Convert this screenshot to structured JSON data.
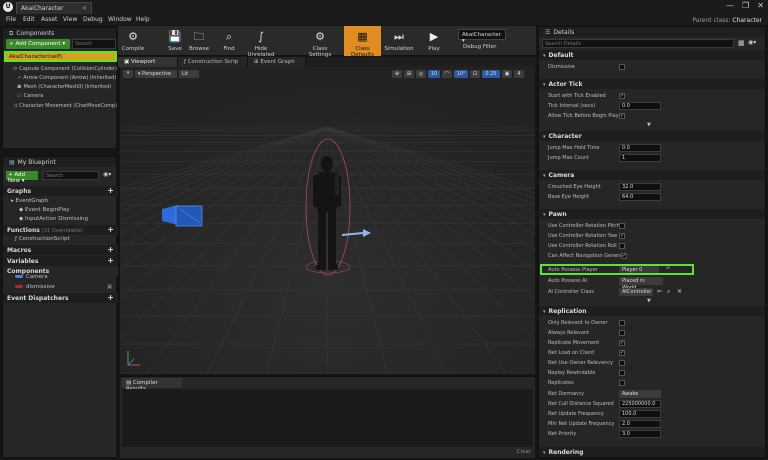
{
  "titlebar": {
    "logo": "U",
    "tab_title": "AkaiCharacter",
    "minimize": "—",
    "restore": "❐",
    "close": "✕"
  },
  "menubar": {
    "items": [
      "File",
      "Edit",
      "Asset",
      "View",
      "Debug",
      "Window",
      "Help"
    ],
    "parent_class_label": "Parent class:",
    "parent_class_value": "Character"
  },
  "components": {
    "title": "Components",
    "add_button": "+ Add Component ▾",
    "search_placeholder": "Search",
    "self_item": "AkaiCharacter(self)",
    "tree": [
      "Capsule Component (CollisionCylinder)",
      "Arrow Component (Arrow) (Inherited)",
      "Mesh (CharacterMesh0) (Inherited)",
      "Camera",
      "Character Movement (CharMoveComp)"
    ]
  },
  "my_blueprint": {
    "title": "My Blueprint",
    "add_button": "+ Add New ▾",
    "search_placeholder": "Search",
    "categories": {
      "graphs": "Graphs",
      "functions": "Functions",
      "functions_sub": "(31 Overridable)",
      "macros": "Macros",
      "variables": "Variables",
      "components": "Components",
      "dispatchers": "Event Dispatchers"
    },
    "graph_items": [
      "EventGraph",
      "Event BeginPlay",
      "InputAction Dismissing"
    ],
    "function_items": [
      "ConstructionScript"
    ],
    "component_vars": [
      "Camera",
      "dismissive"
    ],
    "var_colors": [
      "#4d7fd8",
      "#b0243a"
    ]
  },
  "toolbar": {
    "compile": "Compile",
    "save": "Save",
    "browse": "Browse",
    "find": "Find",
    "hide_unrelated": "Hide Unrelated",
    "class_settings": "Class Settings",
    "class_defaults": "Class Defaults",
    "simulation": "Simulation",
    "play": "Play",
    "debug_object": "AkaiCharacter ▾",
    "debug_filter": "Debug Filter"
  },
  "tabs": [
    "Viewport",
    "Construction Scrip",
    "Event Graph"
  ],
  "viewport": {
    "menu": "▾",
    "perspective": "Perspective",
    "lit": "Lit",
    "right_controls": [
      "⊕",
      "⊞",
      "◎",
      "10",
      "⌒",
      "10°",
      "⊡",
      "0.25",
      "▣",
      "4"
    ]
  },
  "compiler": {
    "title": "Compiler Results",
    "clear": "Clear"
  },
  "details": {
    "title": "Details",
    "search_placeholder": "Search Details",
    "sections": {
      "default": "Default",
      "actor_tick": "Actor Tick",
      "character": "Character",
      "camera": "Camera",
      "pawn": "Pawn",
      "replication": "Replication",
      "rendering": "Rendering"
    },
    "rows": {
      "dismissive": "Dismissive",
      "start_tick": "Start with Tick Enabled",
      "tick_interval": "Tick Interval (secs)",
      "tick_interval_val": "0.0",
      "allow_tick": "Allow Tick Before Begin Play",
      "jump_hold": "Jump Max Hold Time",
      "jump_hold_val": "0.0",
      "jump_count": "Jump Max Count",
      "jump_count_val": "1",
      "crouched_eye": "Crouched Eye Height",
      "crouched_eye_val": "32.0",
      "base_eye": "Base Eye Height",
      "base_eye_val": "64.0",
      "rot_pitch": "Use Controller Rotation Pitch",
      "rot_yaw": "Use Controller Rotation Yaw",
      "rot_roll": "Use Controller Rotation Roll",
      "nav_gen": "Can Affect Navigation Generati",
      "auto_possess_player": "Auto Possess Player",
      "auto_possess_player_val": "Player 0",
      "auto_possess_ai": "Auto Possess AI",
      "auto_possess_ai_val": "Placed in World",
      "ai_controller": "AI Controller Class",
      "ai_controller_val": "AIController",
      "only_owner": "Only Relevant to Owner",
      "always_relevant": "Always Relevant",
      "rep_movement": "Replicate Movement",
      "net_load": "Net Load on Client",
      "net_owner_rel": "Net Use Owner Relevancy",
      "replay_rewind": "Replay Rewindable",
      "replicates": "Replicates",
      "net_dormancy": "Net Dormancy",
      "net_dormancy_val": "Awake",
      "net_cull": "Net Cull Distance Squared",
      "net_cull_val": "225000000.0",
      "net_update": "Net Update Frequency",
      "net_update_val": "100.0",
      "min_net_update": "Min Net Update Frequency",
      "min_net_update_val": "2.0",
      "net_priority": "Net Priority",
      "net_priority_val": "3.0"
    },
    "checked_mark": "✓",
    "highlight_color": "#59e43a"
  }
}
